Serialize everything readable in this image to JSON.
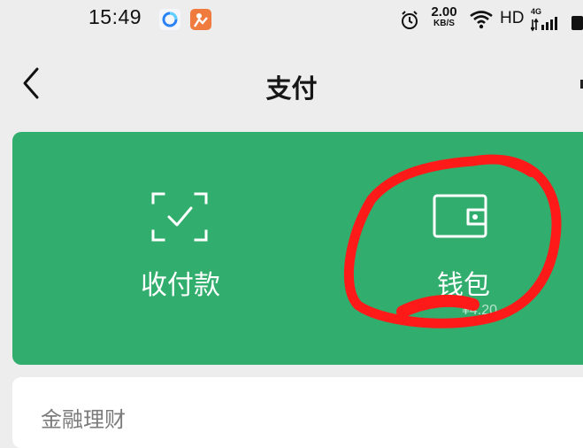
{
  "status_bar": {
    "time": "15:49",
    "net_speed_value": "2.00",
    "net_speed_unit": "KB/S",
    "network_type": "HD",
    "signal_label": "4G",
    "icons": [
      "browser-app-icon",
      "orange-app-icon",
      "alarm-icon",
      "wifi-icon",
      "signal-icon",
      "battery-icon"
    ]
  },
  "header": {
    "back_icon": "chevron-left-icon",
    "title": "支付"
  },
  "pay_card": {
    "background_color": "#31ae6d",
    "collect": {
      "icon": "scan-check-icon",
      "label": "收付款"
    },
    "wallet": {
      "icon": "wallet-icon",
      "label": "钱包",
      "balance_fragment": "¥4.20"
    }
  },
  "annotation": {
    "color": "#ff1a1a",
    "shape": "hand-drawn-circle-around-wallet"
  },
  "finance": {
    "title": "金融理财"
  }
}
